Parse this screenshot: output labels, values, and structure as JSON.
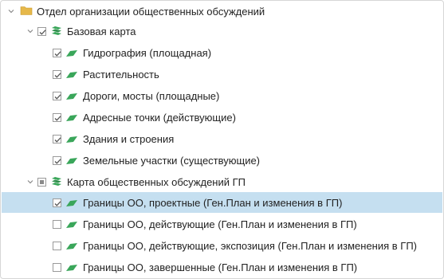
{
  "colors": {
    "folder": "#e6b84a",
    "layer": "#3aa65a",
    "selected_row": "#c5dff0"
  },
  "tree": {
    "root": {
      "label": "Отдел организации общественных обсуждений",
      "icon": "folder-icon",
      "expanded": true
    },
    "group1": {
      "label": "Базовая карта",
      "icon": "layers-icon",
      "checked": true,
      "expanded": true,
      "items": [
        {
          "label": "Гидрография (площадная)",
          "checked": true
        },
        {
          "label": "Растительность",
          "checked": true
        },
        {
          "label": "Дороги, мосты (площадные)",
          "checked": true
        },
        {
          "label": "Адресные точки (действующие)",
          "checked": true
        },
        {
          "label": "Здания и строения",
          "checked": true
        },
        {
          "label": "Земельные участки (существующие)",
          "checked": true
        }
      ]
    },
    "group2": {
      "label": "Карта общественных обсуждений ГП",
      "icon": "layers-icon",
      "checked": "partial",
      "expanded": true,
      "items": [
        {
          "label": "Границы ОО, проектные (Ген.План и изменения в ГП)",
          "checked": true,
          "selected": true
        },
        {
          "label": "Границы ОО, действующие (Ген.План и изменения в ГП)",
          "checked": false
        },
        {
          "label": "Границы ОО, действующие, экспозиция (Ген.План и изменения в ГП)",
          "checked": false
        },
        {
          "label": "Границы ОО, завершенные (Ген.План и изменения в ГП)",
          "checked": false
        }
      ]
    }
  }
}
